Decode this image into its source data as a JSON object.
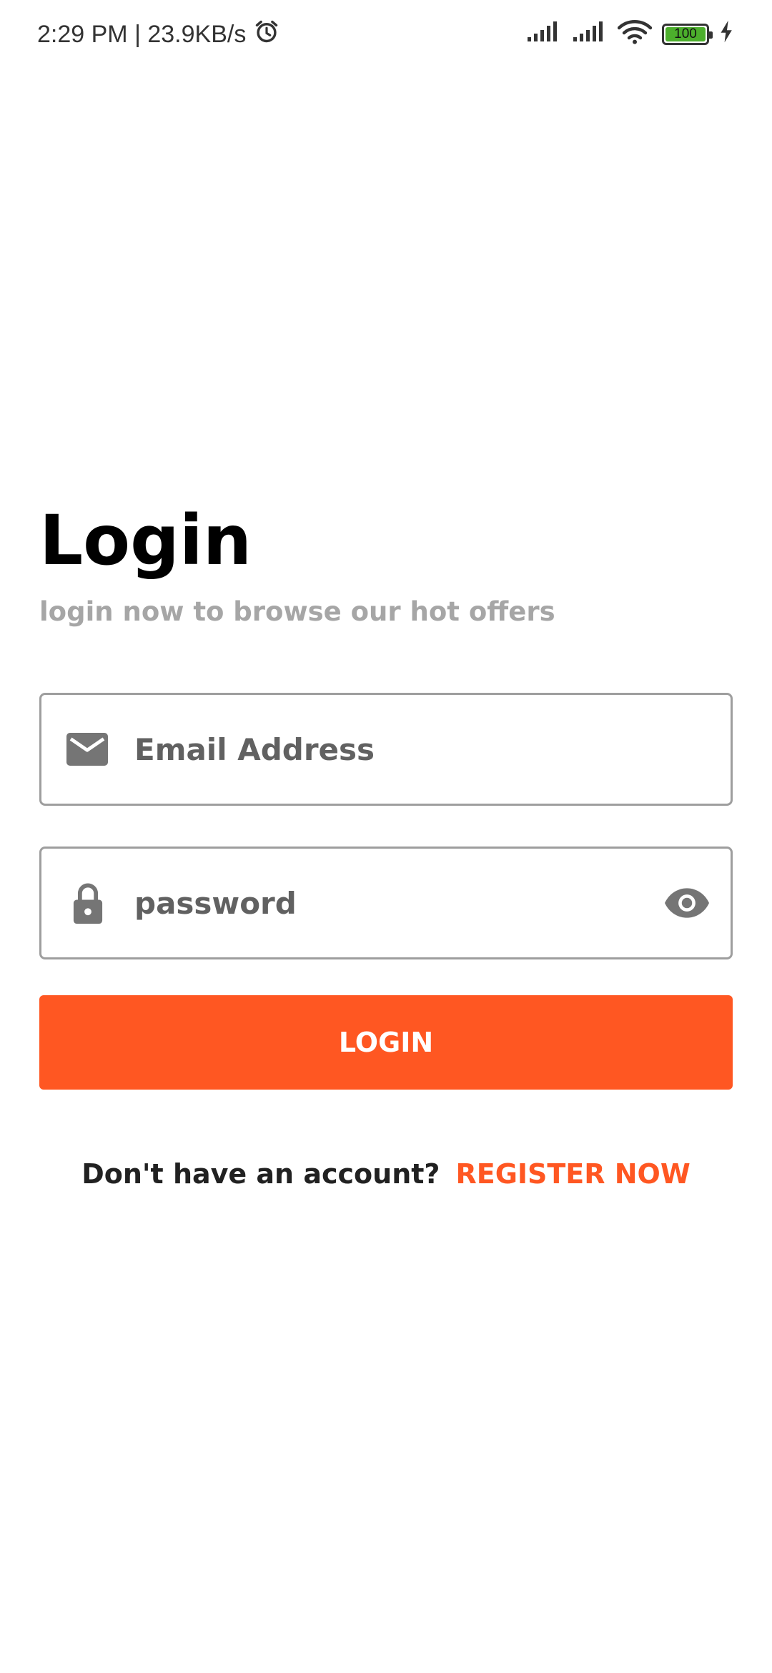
{
  "status_bar": {
    "time_speed": "2:29 PM | 23.9KB/s",
    "battery_level": "100",
    "battery_fraction": 1.0
  },
  "login": {
    "title": "Login",
    "subtitle": "login now to browse our hot offers",
    "email_placeholder": "Email Address",
    "email_value": "",
    "password_placeholder": "password",
    "password_value": "",
    "button_label": "LOGIN"
  },
  "register": {
    "prompt": "Don't have an account?",
    "link_label": "REGISTER NOW"
  },
  "colors": {
    "accent": "#ff5722",
    "field_border": "#9e9e9e",
    "subtitle": "#a6a6a6",
    "icon": "#757575"
  },
  "icons": [
    "alarm-icon",
    "signal-icon",
    "wifi-icon",
    "battery-icon",
    "charging-icon",
    "mail-icon",
    "lock-icon",
    "eye-icon"
  ]
}
